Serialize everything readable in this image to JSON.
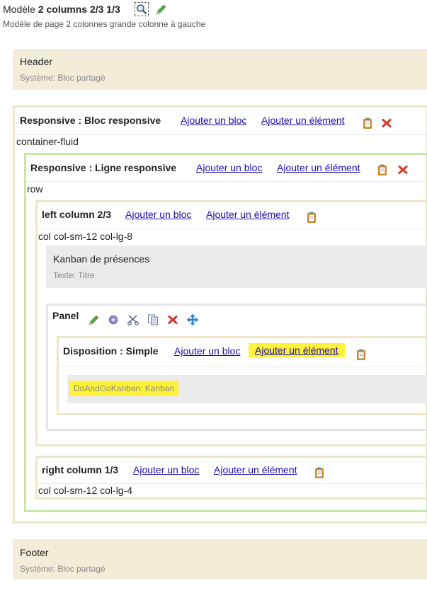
{
  "page": {
    "title_prefix": "Modèle",
    "title_bold": "2 columns 2/3 1/3",
    "subtitle": "Modèle de page 2 colonnes grande colonne à gauche"
  },
  "header_block": {
    "title": "Header",
    "system": "Système: Bloc partagé"
  },
  "footer_block": {
    "title": "Footer",
    "system": "Système: Bloc partagé"
  },
  "responsive_block": {
    "title": "Responsive : Bloc responsive",
    "add_block": "Ajouter un bloc",
    "add_element": "Ajouter un élément",
    "css_class": "container-fluid"
  },
  "responsive_row": {
    "title": "Responsive : Ligne responsive",
    "add_block": "Ajouter un bloc",
    "add_element": "Ajouter un élément",
    "css_class": "row"
  },
  "left_column": {
    "title": "left column 2/3",
    "add_block": "Ajouter un bloc",
    "add_element": "Ajouter un élément",
    "css_class": "col col-sm-12 col-lg-8"
  },
  "kanban_title_block": {
    "title": "Kanban de présences",
    "type": "Texte: Titre"
  },
  "panel": {
    "title": "Panel"
  },
  "disposition": {
    "title": "Disposition : Simple",
    "add_block": "Ajouter un bloc",
    "add_element": "Ajouter un élément"
  },
  "kanban_element": {
    "label": "DoAndGoKanban: Kanban"
  },
  "right_column": {
    "title": "right column 1/3",
    "add_block": "Ajouter un bloc",
    "add_element": "Ajouter un élément",
    "css_class": "col col-sm-12 col-lg-4"
  },
  "colors": {
    "beige": "#f3ecd9",
    "beige_border": "#efe6c9",
    "green_border": "#c7e6a8",
    "highlight": "#fff23a",
    "link": "#1a0dab"
  }
}
